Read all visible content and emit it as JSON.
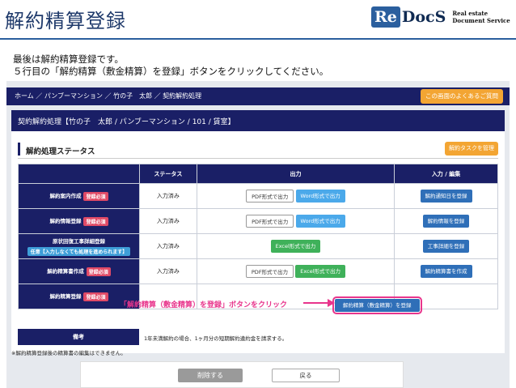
{
  "slide": {
    "title": "解約精算登録",
    "instruction_line1": "最後は解約精算登録です。",
    "instruction_line2": "５行目の「解約精算（敷金精算）を登録」ボタンをクリックしてください。"
  },
  "logo": {
    "re": "Re",
    "docs": "DocS",
    "sub_line1": "Real estate",
    "sub_line2": "Document Service"
  },
  "header": {
    "breadcrumb": "ホーム ／ パンブーマンション ／ 竹の子　太郎 ／ 契約解約処理",
    "faq_button": "この画面のよくあるご質問"
  },
  "process": {
    "title": "契約解約処理【竹の子　太郎 / パンブーマンション / 101 / 賃室】",
    "status_title": "解約処理ステータス",
    "cancel_task_button": "解約タスクを管理"
  },
  "table": {
    "headers": [
      "",
      "ステータス",
      "出力",
      "入力 / 編集"
    ],
    "rows": [
      {
        "name": "解約案内作成",
        "badge": "登録必須",
        "status": "入力済み",
        "outputs": [
          "PDF形式で出力",
          "Word形式で出力"
        ],
        "action": "解約通知日を登録"
      },
      {
        "name": "解約情報登録",
        "badge": "登録必須",
        "status": "入力済み",
        "outputs": [
          "PDF形式で出力",
          "Word形式で出力"
        ],
        "action": "解約情報を登録"
      },
      {
        "name": "原状回復工事詳細登録",
        "sub_badge": "任意【入力しなくても処理を進められます】",
        "status": "入力済み",
        "outputs": [
          "Excel形式で出力"
        ],
        "action": "工事詳細を登録"
      },
      {
        "name": "解約精算書作成",
        "badge": "登録必須",
        "status": "入力済み",
        "outputs": [
          "PDF形式で出力",
          "Excel形式で出力"
        ],
        "action": "解約精算書を作成"
      },
      {
        "name": "解約精算登録",
        "badge": "登録必須",
        "status": "",
        "outputs": [],
        "action": "解約精算（敷金精算）を登録"
      }
    ]
  },
  "biko": {
    "label": "備考",
    "text": "1年未満解約の場合、1ヶ月分の短期解約違約金を請求する。"
  },
  "note": "※解約精算登録後の精算書の編集はできません。",
  "callout": "「解約精算（敷金精算）を登録」ボタンをクリック",
  "footer": {
    "delete_button": "削除する",
    "back_button": "戻る"
  },
  "colors": {
    "navy": "#1a1f66",
    "orange": "#f3a533",
    "pink": "#e8358c",
    "green": "#3fb15a",
    "blue": "#2f6fb8"
  }
}
